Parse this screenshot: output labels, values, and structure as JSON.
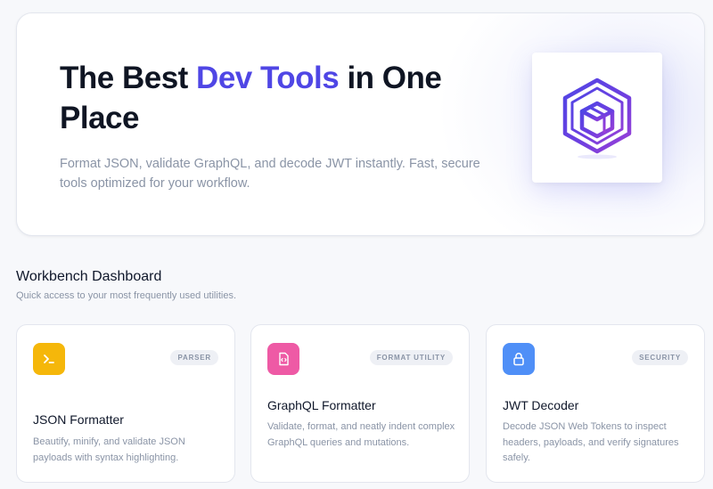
{
  "hero": {
    "title_part1": "The Best ",
    "title_accent": "Dev Tools",
    "title_part2": " in One Place",
    "subtitle": "Format JSON, validate GraphQL, and decode JWT instantly. Fast, secure tools optimized for your workflow.",
    "logo_icon": "isometric-box-logo-icon"
  },
  "dashboard": {
    "title": "Workbench Dashboard",
    "subtitle": "Quick access to your most frequently used utilities."
  },
  "cards": [
    {
      "title": "JSON Formatter",
      "badge": "PARSER",
      "description": "Beautify, minify, and validate JSON payloads with syntax highlighting.",
      "icon": "terminal-icon",
      "icon_color": "#f5b70a"
    },
    {
      "title": "GraphQL Formatter",
      "badge": "FORMAT UTILITY",
      "description": "Validate, format, and neatly indent complex GraphQL queries and mutations.",
      "icon": "code-file-icon",
      "icon_color": "#ee5aa5"
    },
    {
      "title": "JWT Decoder",
      "badge": "SECURITY",
      "description": "Decode JSON Web Tokens to inspect headers, payloads, and verify signatures safely.",
      "icon": "lock-icon",
      "icon_color": "#4f8ff7"
    }
  ],
  "colors": {
    "accent": "#4f46e5",
    "background": "#f7f8fb",
    "muted_text": "#8a94a6"
  }
}
